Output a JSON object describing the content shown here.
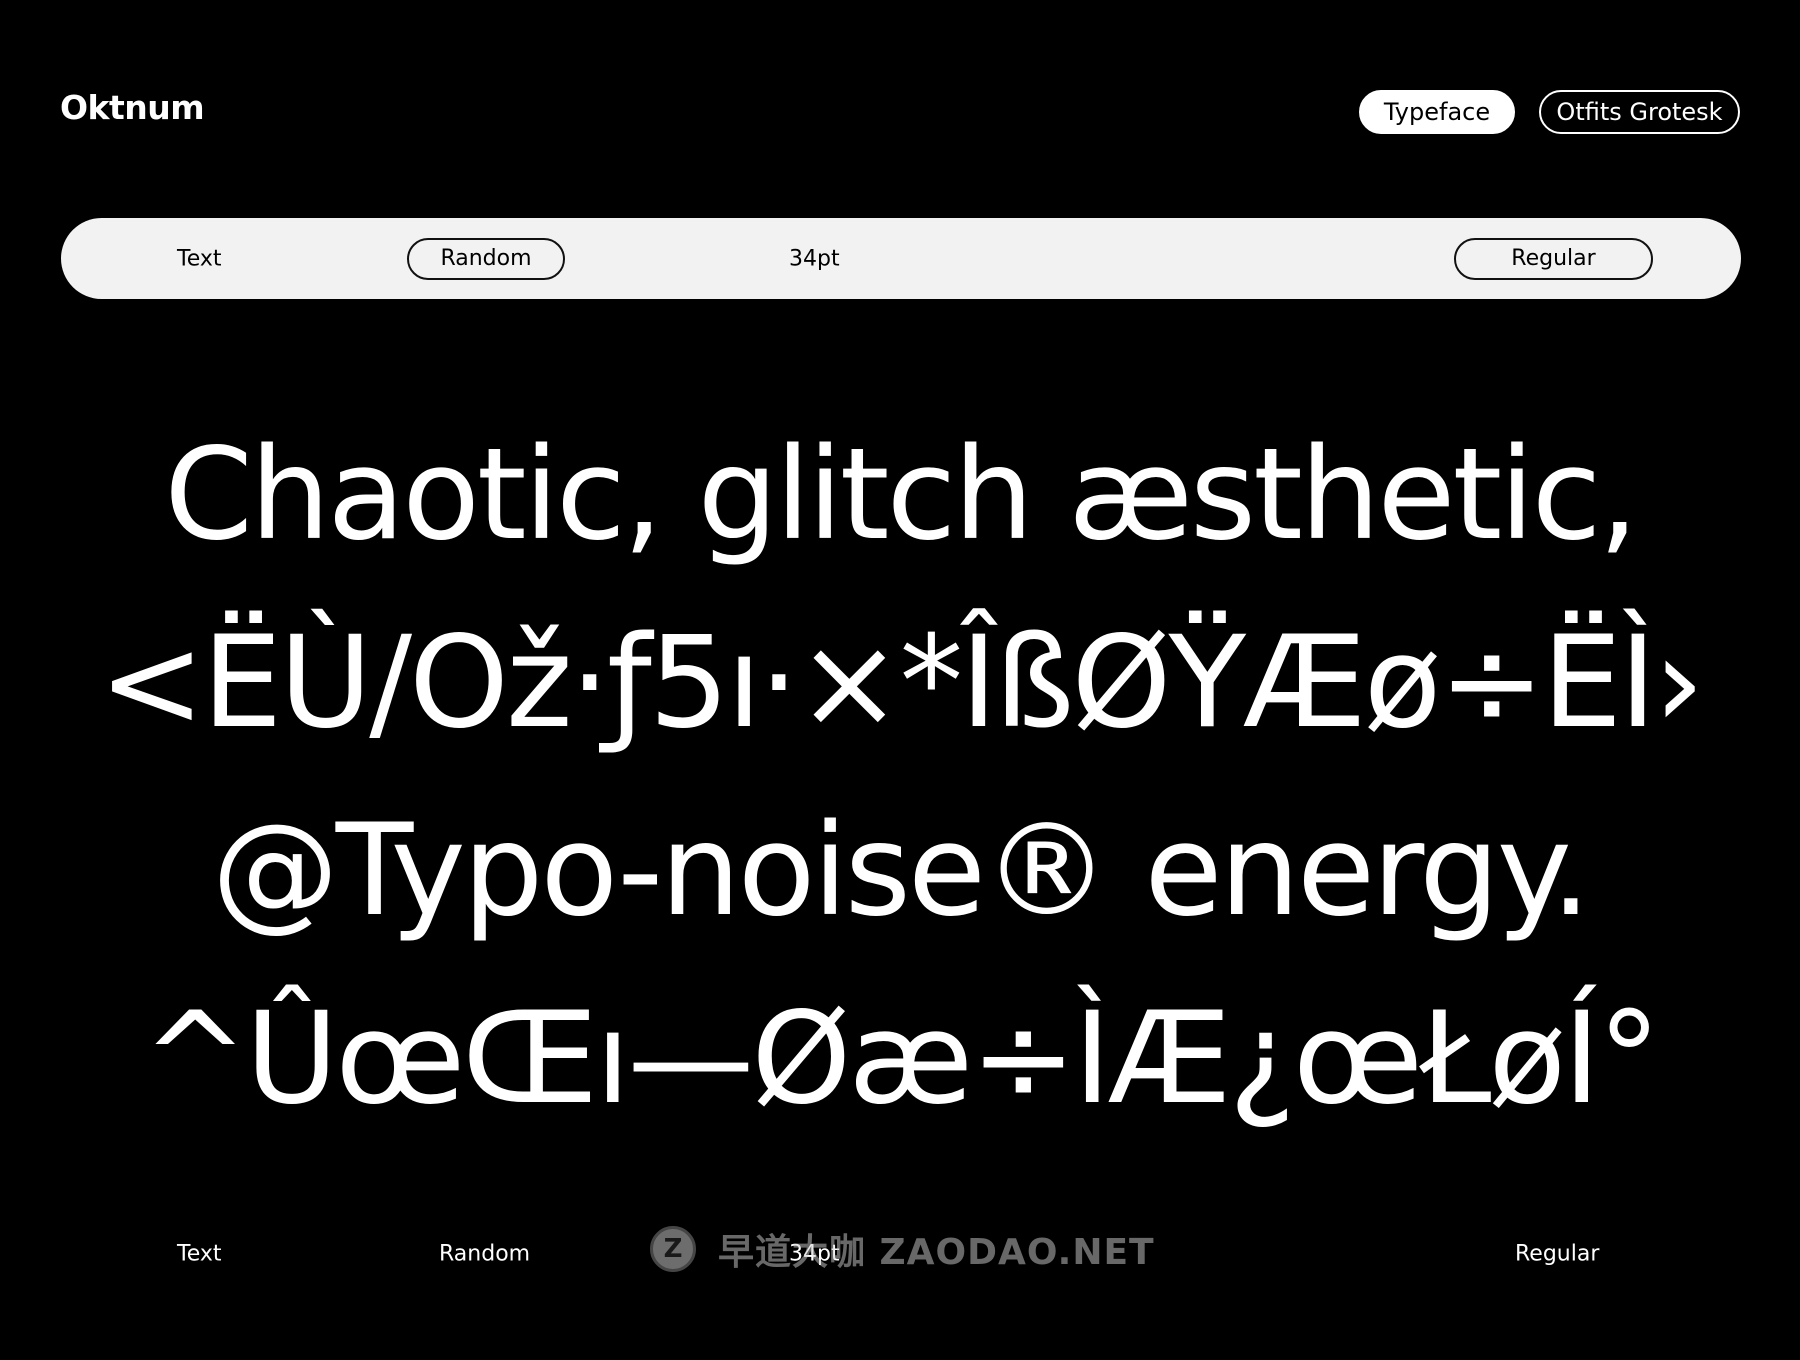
{
  "header": {
    "brand": "Oktnum",
    "tabs": [
      {
        "label": "Typeface",
        "active": true
      },
      {
        "label": "Otfits Grotesk",
        "active": false
      }
    ]
  },
  "toolbar": {
    "mode_label": "Text",
    "random_label": "Random",
    "size_label": "34pt",
    "weight_label": "Regular"
  },
  "specimen": {
    "lines": [
      "Chaotic, glitch æsthetic,",
      "<ËÙ/Ož·ƒ5ı·×*ÎßØŸÆø÷ËÌ›",
      "@Typo-noise® energy.",
      "^ÛœŒı—Øæ÷ÌÆ¿œŁøÍ°"
    ]
  },
  "footer": {
    "mode_label": "Text",
    "random_label": "Random",
    "size_label": "34pt",
    "weight_label": "Regular"
  },
  "watermark": {
    "badge": "Z",
    "text": "早道大咖 ZAODAO.NET"
  },
  "colors": {
    "background": "#000000",
    "foreground": "#ffffff",
    "toolbar_bg": "#f2f2f2"
  }
}
